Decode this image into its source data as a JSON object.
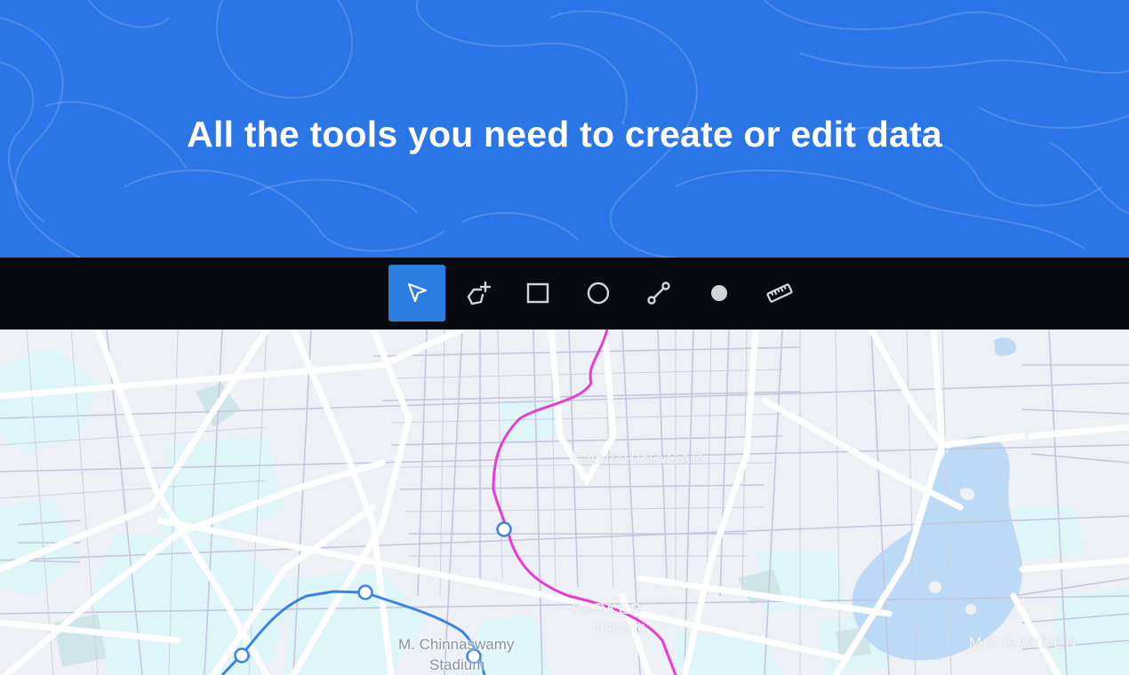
{
  "hero": {
    "title": "All the tools you need to create or edit data",
    "background_color": "#2b76e6"
  },
  "toolbar": {
    "active_color": "#2b7de0",
    "tools": [
      {
        "name": "select-tool",
        "icon": "cursor-arrow-icon",
        "active": true
      },
      {
        "name": "polygon-tool",
        "icon": "polygon-add-icon",
        "active": false
      },
      {
        "name": "rectangle-tool",
        "icon": "square-icon",
        "active": false
      },
      {
        "name": "circle-tool",
        "icon": "circle-icon",
        "active": false
      },
      {
        "name": "line-tool",
        "icon": "line-segment-icon",
        "active": false
      },
      {
        "name": "point-tool",
        "icon": "filled-dot-icon",
        "active": false
      },
      {
        "name": "measure-tool",
        "icon": "ruler-icon",
        "active": false
      }
    ]
  },
  "map": {
    "labels": {
      "district_1": "GANDHINAGAR",
      "district_2_line1": "PARKER",
      "district_2_line2": "TOWN",
      "stadium_line1": "M. Chinnaswamy",
      "stadium_line2": "Stadium",
      "garden": "MG GARDEN"
    },
    "pink_route_color": "#e63ccf",
    "blue_route_color": "#3b82e6",
    "water_color": "#bcd9f5",
    "park_color": "#dff6f8"
  }
}
